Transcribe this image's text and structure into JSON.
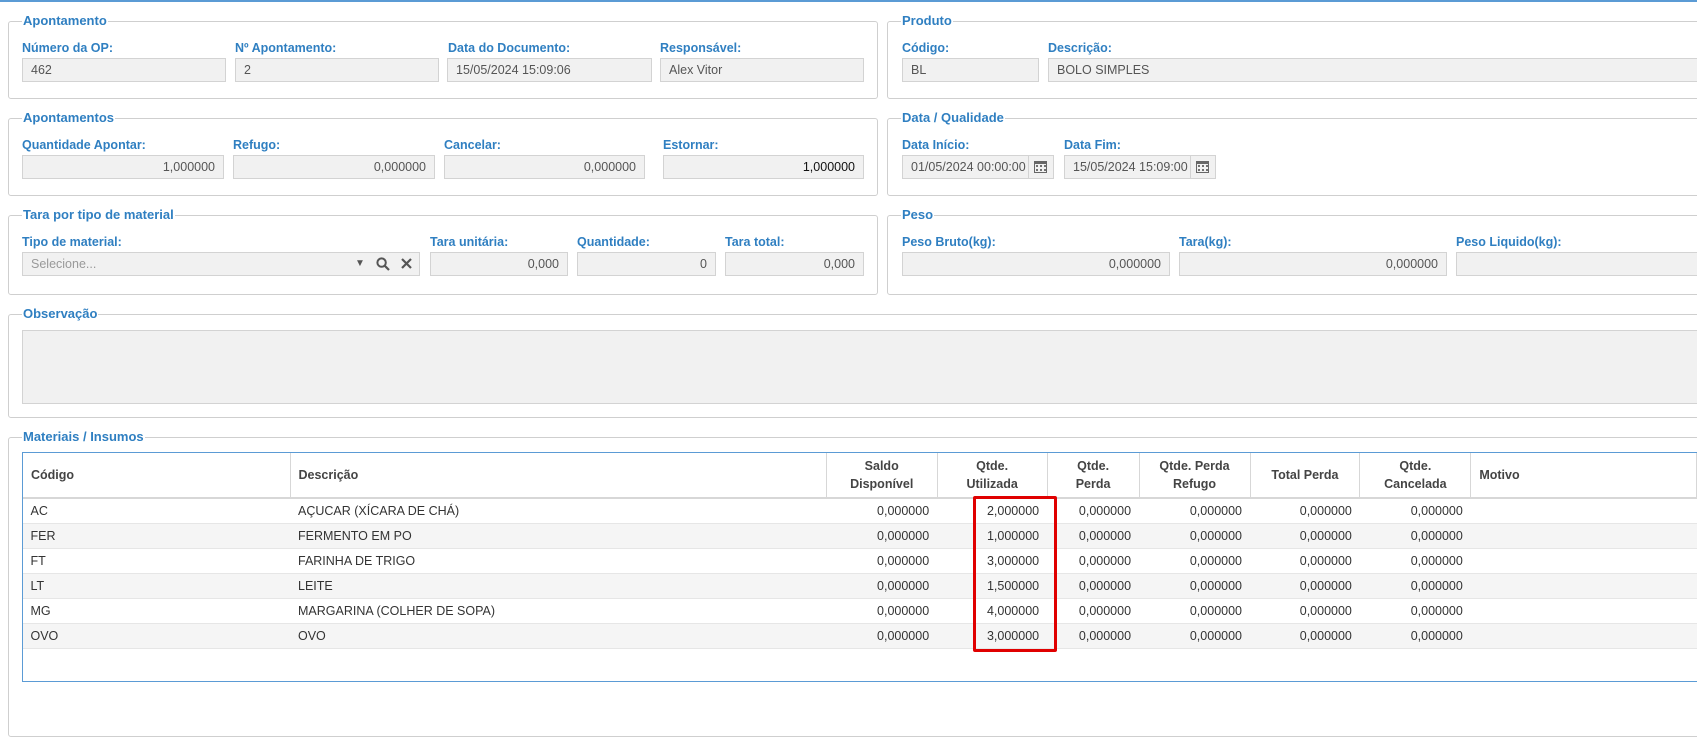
{
  "apontamento": {
    "legend": "Apontamento",
    "numero_op_label": "Número da OP:",
    "numero_op": "462",
    "n_apontamento_label": "Nº Apontamento:",
    "n_apontamento": "2",
    "data_documento_label": "Data do Documento:",
    "data_documento": "15/05/2024 15:09:06",
    "responsavel_label": "Responsável:",
    "responsavel": "Alex Vitor"
  },
  "produto": {
    "legend": "Produto",
    "codigo_label": "Código:",
    "codigo": "BL",
    "descricao_label": "Descrição:",
    "descricao": "BOLO SIMPLES"
  },
  "apontamentos": {
    "legend": "Apontamentos",
    "qtd_apontar_label": "Quantidade Apontar:",
    "qtd_apontar": "1,000000",
    "refugo_label": "Refugo:",
    "refugo": "0,000000",
    "cancelar_label": "Cancelar:",
    "cancelar": "0,000000",
    "estornar_label": "Estornar:",
    "estornar": "1,000000"
  },
  "data_qualidade": {
    "legend": "Data / Qualidade",
    "data_inicio_label": "Data Início:",
    "data_inicio": "01/05/2024 00:00:00",
    "data_fim_label": "Data Fim:",
    "data_fim": "15/05/2024 15:09:00"
  },
  "tara": {
    "legend": "Tara por tipo de material",
    "tipo_label": "Tipo de material:",
    "tipo_placeholder": "Selecione...",
    "tara_unitaria_label": "Tara unitária:",
    "tara_unitaria": "0,000",
    "quantidade_label": "Quantidade:",
    "quantidade": "0",
    "tara_total_label": "Tara total:",
    "tara_total": "0,000"
  },
  "peso": {
    "legend": "Peso",
    "peso_bruto_label": "Peso Bruto(kg):",
    "peso_bruto": "0,000000",
    "tara_label": "Tara(kg):",
    "tara": "0,000000",
    "peso_liquido_label": "Peso Liquido(kg):"
  },
  "observacao": {
    "legend": "Observação",
    "value": ""
  },
  "materiais": {
    "legend": "Materiais / Insumos",
    "columns": [
      "Código",
      "Descrição",
      "Saldo Disponível",
      "Qtde. Utilizada",
      "Qtde. Perda",
      "Qtde. Perda Refugo",
      "Total Perda",
      "Qtde. Cancelada",
      "Motivo"
    ],
    "rows": [
      [
        "AC",
        "AÇUCAR (XÍCARA DE CHÁ)",
        "0,000000",
        "2,000000",
        "0,000000",
        "0,000000",
        "0,000000",
        "0,000000",
        ""
      ],
      [
        "FER",
        "FERMENTO EM PO",
        "0,000000",
        "1,000000",
        "0,000000",
        "0,000000",
        "0,000000",
        "0,000000",
        ""
      ],
      [
        "FT",
        "FARINHA DE TRIGO",
        "0,000000",
        "3,000000",
        "0,000000",
        "0,000000",
        "0,000000",
        "0,000000",
        ""
      ],
      [
        "LT",
        "LEITE",
        "0,000000",
        "1,500000",
        "0,000000",
        "0,000000",
        "0,000000",
        "0,000000",
        ""
      ],
      [
        "MG",
        "MARGARINA (COLHER DE SOPA)",
        "0,000000",
        "4,000000",
        "0,000000",
        "0,000000",
        "0,000000",
        "0,000000",
        ""
      ],
      [
        "OVO",
        "OVO",
        "0,000000",
        "3,000000",
        "0,000000",
        "0,000000",
        "0,000000",
        "0,000000",
        ""
      ]
    ]
  },
  "colors": {
    "accent": "#2f7fc1",
    "highlight": "#e00000"
  }
}
